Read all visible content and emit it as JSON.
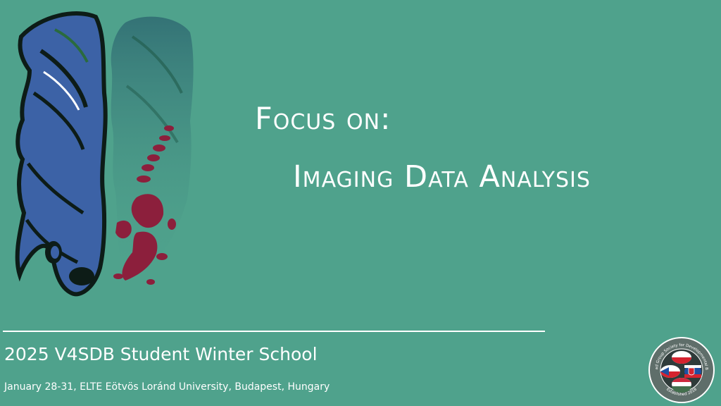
{
  "slide": {
    "heading_line1": "Focus on:",
    "heading_line2": "Imaging Data Analysis",
    "event_title": "2025 V4SDB Student Winter School",
    "event_details": "January 28-31, ELTE Eötvös Loránd University, Budapest, Hungary",
    "logo": {
      "top_text": "Visegrad Group Society for Developmental Biology",
      "bottom_text": "Established 2018"
    }
  },
  "colors": {
    "background": "#4fa28c",
    "text": "#ffffff",
    "fish_blue": "#3c62a6",
    "fish_dark": "#0d1c17",
    "highlight_red": "#8c1f3c"
  },
  "icons": [
    "zebrafish-illustration",
    "society-logo"
  ]
}
